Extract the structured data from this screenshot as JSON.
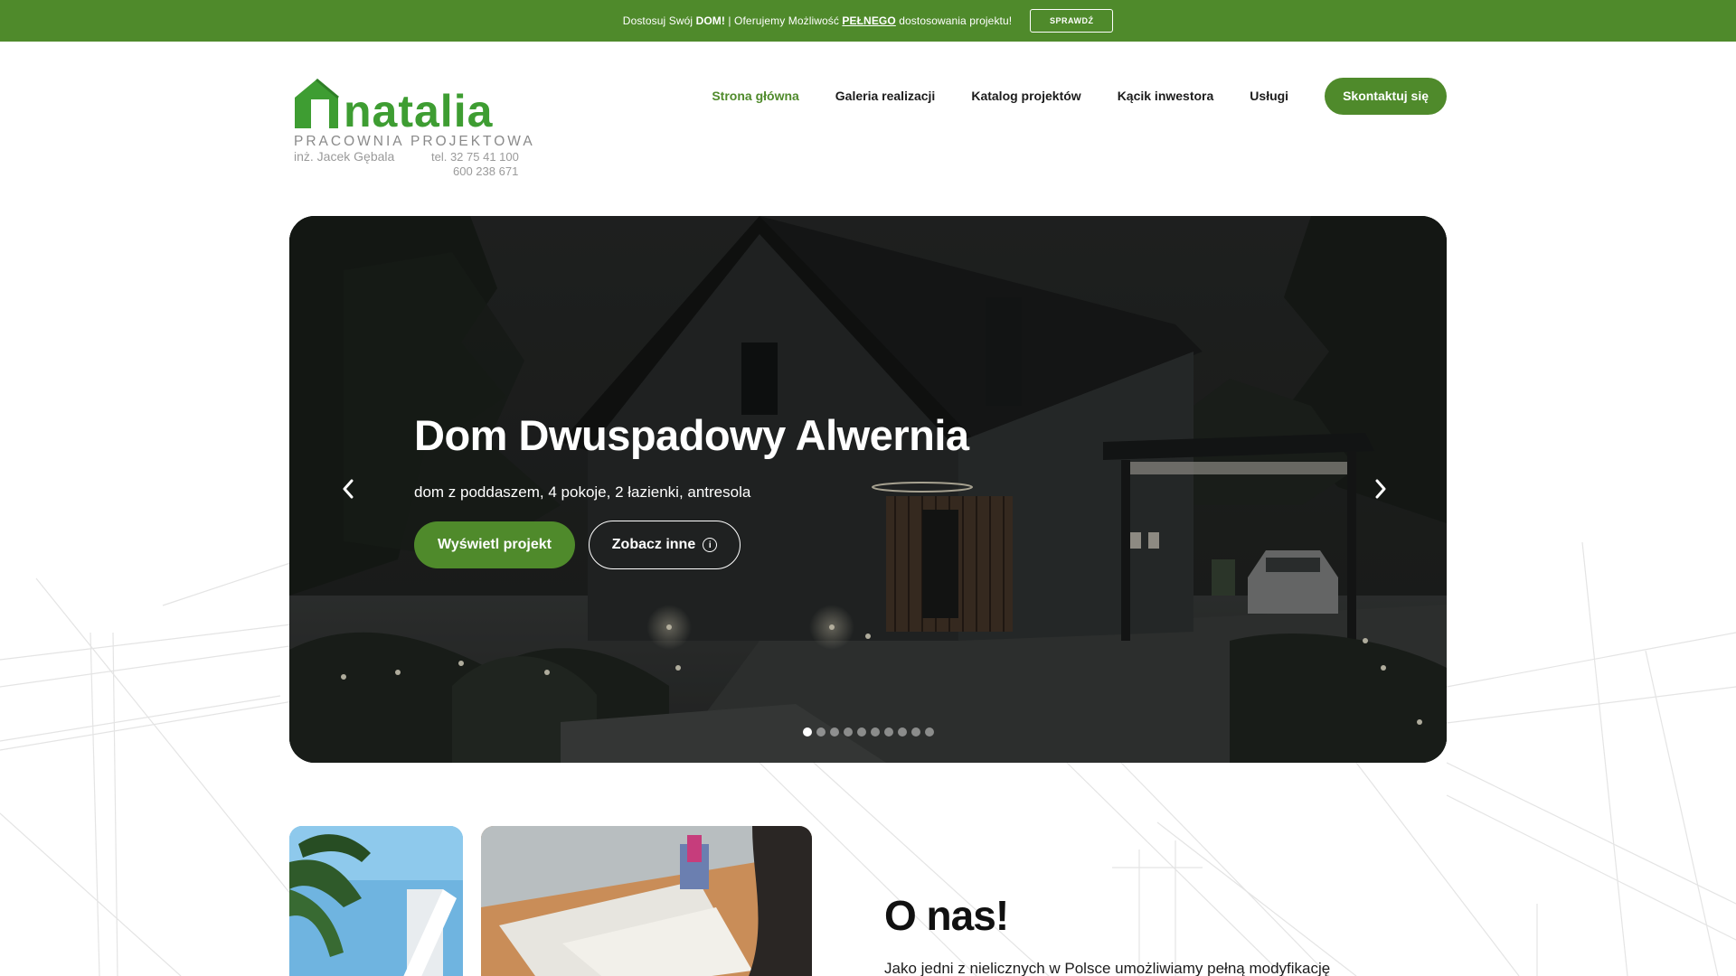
{
  "promo": {
    "pre": "Dostosuj Swój ",
    "dom": "DOM!",
    "mid": " | Oferujemy Możliwość ",
    "full": "PEŁNEGO",
    "post": " dostosowania projektu!",
    "button": "SPRAWDŹ"
  },
  "logo": {
    "word": "natalia",
    "subtitle": "PRACOWNIA PROJEKTOWA",
    "owner": "inż. Jacek Gębala",
    "tel1": "tel. 32 75 41 100",
    "tel2": "600 238 671"
  },
  "nav": {
    "items": [
      "Strona główna",
      "Galeria realizacji",
      "Katalog projektów",
      "Kącik inwestora",
      "Usługi"
    ],
    "active_index": 0,
    "cta": "Skontaktuj się"
  },
  "hero": {
    "title": "Dom Dwuspadowy Alwernia",
    "subtitle": "dom z poddaszem, 4 pokoje, 2 łazienki, antresola",
    "primary_button": "Wyświetl projekt",
    "secondary_button": "Zobacz inne",
    "secondary_icon": "info-icon",
    "prev_icon": "chevron-left-icon",
    "next_icon": "chevron-right-icon",
    "slides_total": 10,
    "active_slide": 1
  },
  "about": {
    "title": "O nas!",
    "text": "Jako jedni z nielicznych w Polsce umożliwiamy pełną modyfikację"
  },
  "colors": {
    "brand_green": "#4f8a2b",
    "logo_green": "#3e9d32"
  }
}
